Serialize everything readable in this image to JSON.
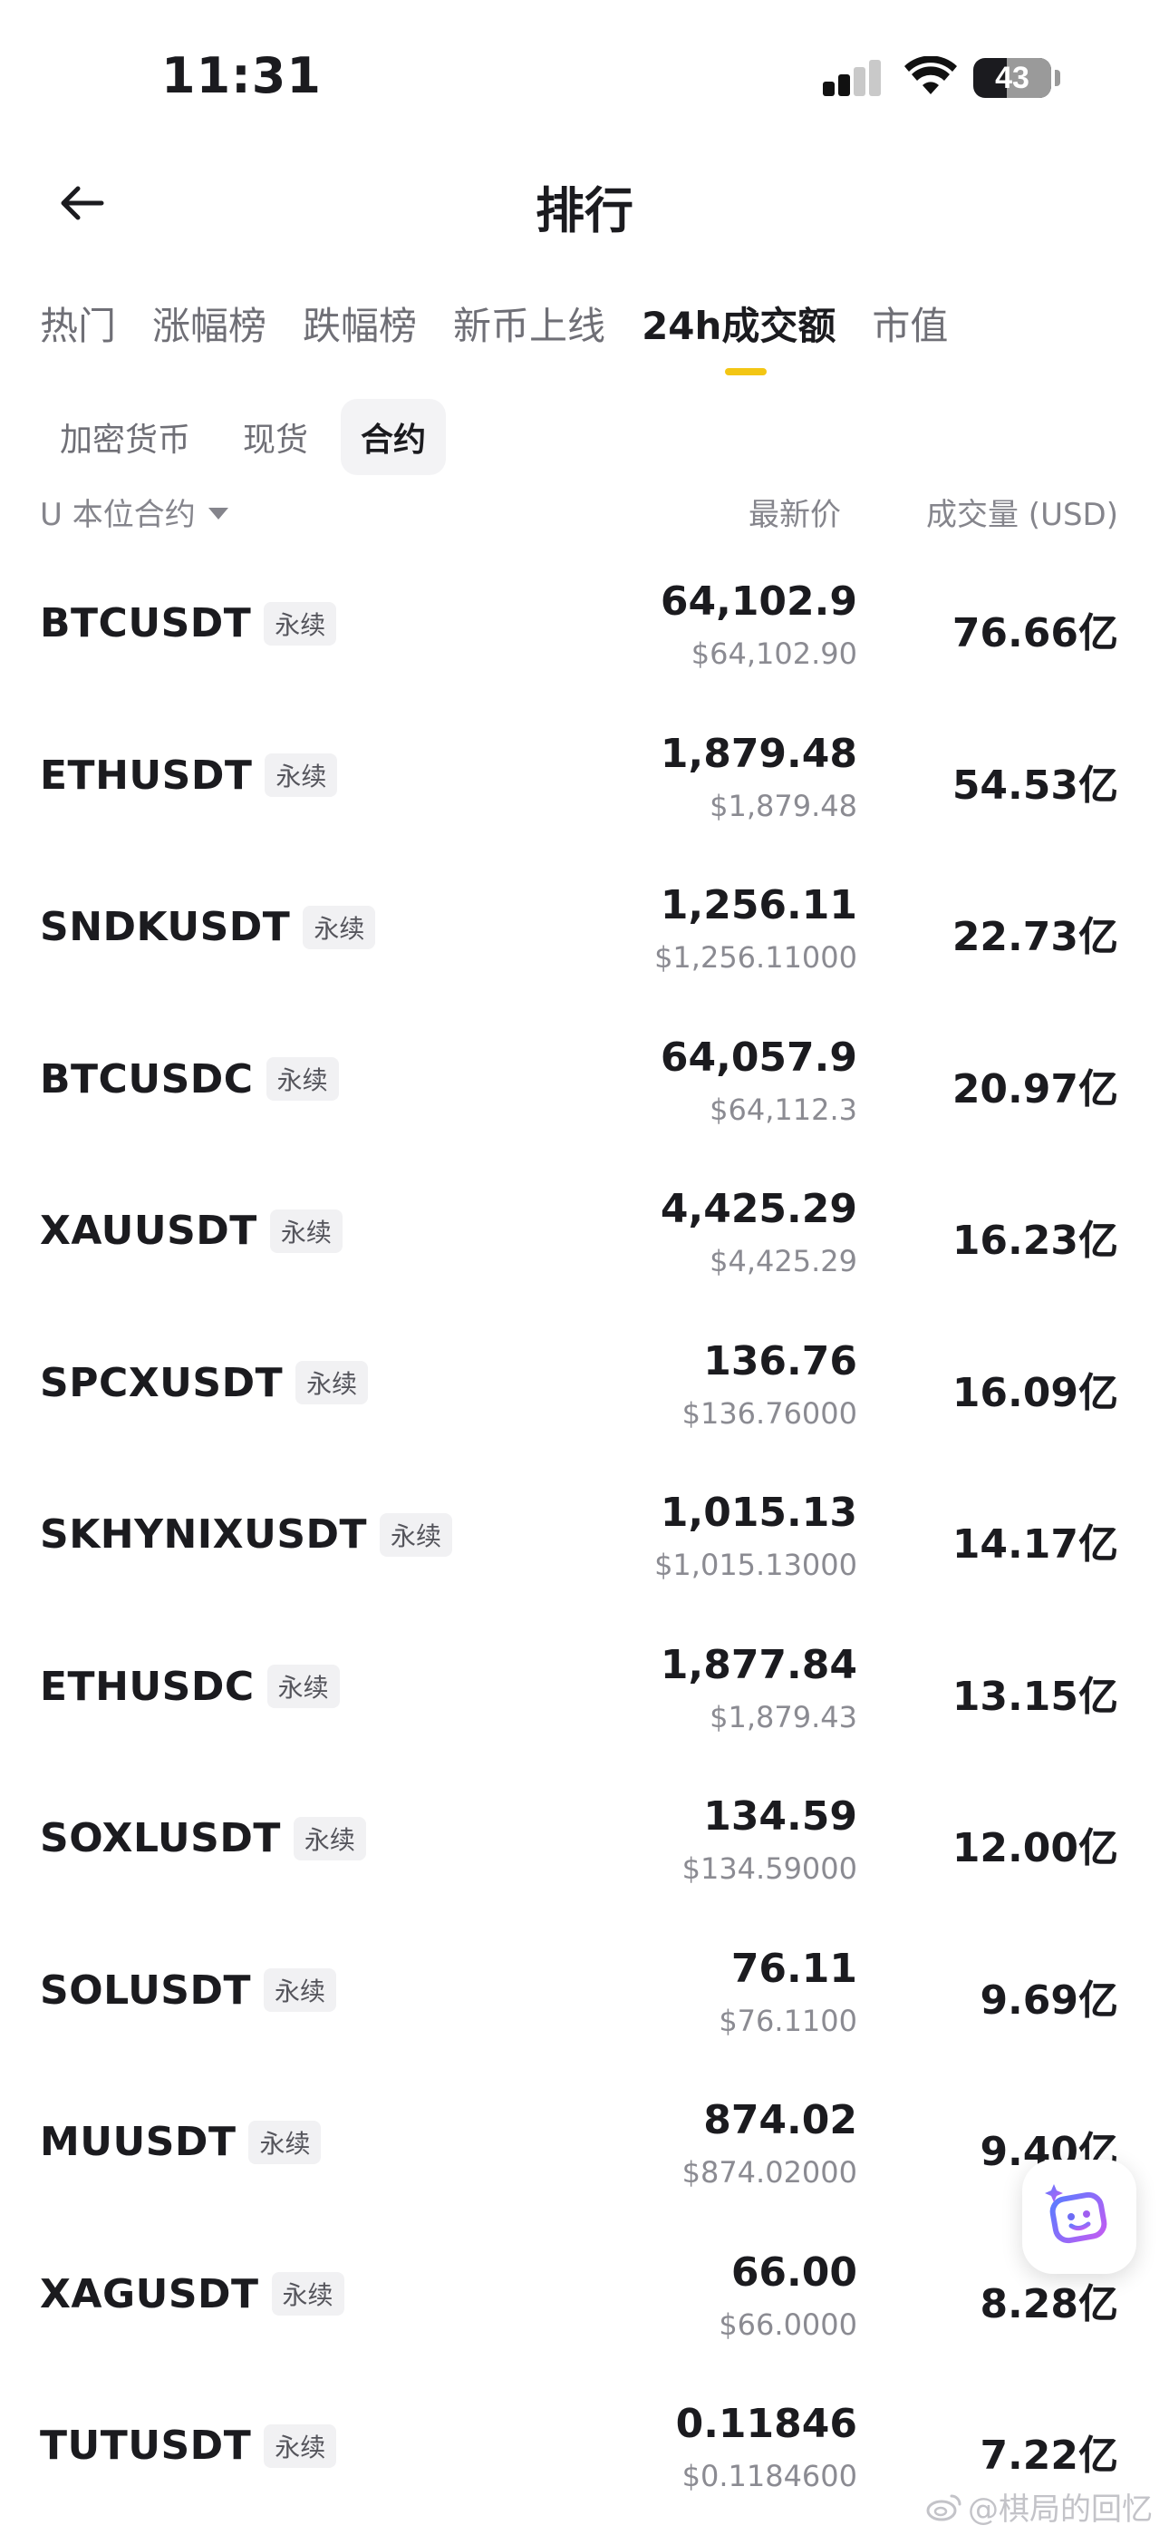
{
  "status_bar": {
    "time": "11:31",
    "battery": "43",
    "battery_level": 0.43
  },
  "header": {
    "title": "排行",
    "back_icon": "arrow-left-icon"
  },
  "tabs": [
    {
      "label": "热门",
      "active": false
    },
    {
      "label": "涨幅榜",
      "active": false
    },
    {
      "label": "跌幅榜",
      "active": false
    },
    {
      "label": "新币上线",
      "active": false
    },
    {
      "label": "24h成交额",
      "active": true
    },
    {
      "label": "市值",
      "active": false
    }
  ],
  "subtabs": [
    {
      "label": "加密货币",
      "active": false
    },
    {
      "label": "现货",
      "active": false
    },
    {
      "label": "合约",
      "active": true
    }
  ],
  "columns": {
    "filter": "U 本位合约",
    "price": "最新价",
    "volume": "成交量 (USD)"
  },
  "rows": [
    {
      "symbol": "BTCUSDT",
      "tag": "永续",
      "price": "64,102.9",
      "price_usd": "$64,102.90",
      "volume": "76.66亿"
    },
    {
      "symbol": "ETHUSDT",
      "tag": "永续",
      "price": "1,879.48",
      "price_usd": "$1,879.48",
      "volume": "54.53亿"
    },
    {
      "symbol": "SNDKUSDT",
      "tag": "永续",
      "price": "1,256.11",
      "price_usd": "$1,256.11000",
      "volume": "22.73亿"
    },
    {
      "symbol": "BTCUSDC",
      "tag": "永续",
      "price": "64,057.9",
      "price_usd": "$64,112.3",
      "volume": "20.97亿"
    },
    {
      "symbol": "XAUUSDT",
      "tag": "永续",
      "price": "4,425.29",
      "price_usd": "$4,425.29",
      "volume": "16.23亿"
    },
    {
      "symbol": "SPCXUSDT",
      "tag": "永续",
      "price": "136.76",
      "price_usd": "$136.76000",
      "volume": "16.09亿"
    },
    {
      "symbol": "SKHYNIXUSDT",
      "tag": "永续",
      "price": "1,015.13",
      "price_usd": "$1,015.13000",
      "volume": "14.17亿"
    },
    {
      "symbol": "ETHUSDC",
      "tag": "永续",
      "price": "1,877.84",
      "price_usd": "$1,879.43",
      "volume": "13.15亿"
    },
    {
      "symbol": "SOXLUSDT",
      "tag": "永续",
      "price": "134.59",
      "price_usd": "$134.59000",
      "volume": "12.00亿"
    },
    {
      "symbol": "SOLUSDT",
      "tag": "永续",
      "price": "76.11",
      "price_usd": "$76.1100",
      "volume": "9.69亿"
    },
    {
      "symbol": "MUUSDT",
      "tag": "永续",
      "price": "874.02",
      "price_usd": "$874.02000",
      "volume": "9.40亿"
    },
    {
      "symbol": "XAGUSDT",
      "tag": "永续",
      "price": "66.00",
      "price_usd": "$66.0000",
      "volume": "8.28亿"
    },
    {
      "symbol": "TUTUSDT",
      "tag": "永续",
      "price": "0.11846",
      "price_usd": "$0.1184600",
      "volume": "7.22亿"
    }
  ],
  "assistant": {
    "icon": "ai-assistant-icon"
  },
  "watermark": {
    "text": "@棋局的回忆",
    "icon": "weibo-icon"
  },
  "colors": {
    "accent": "#f3c614",
    "text_primary": "#1b1b1f",
    "text_secondary": "#85858c"
  }
}
